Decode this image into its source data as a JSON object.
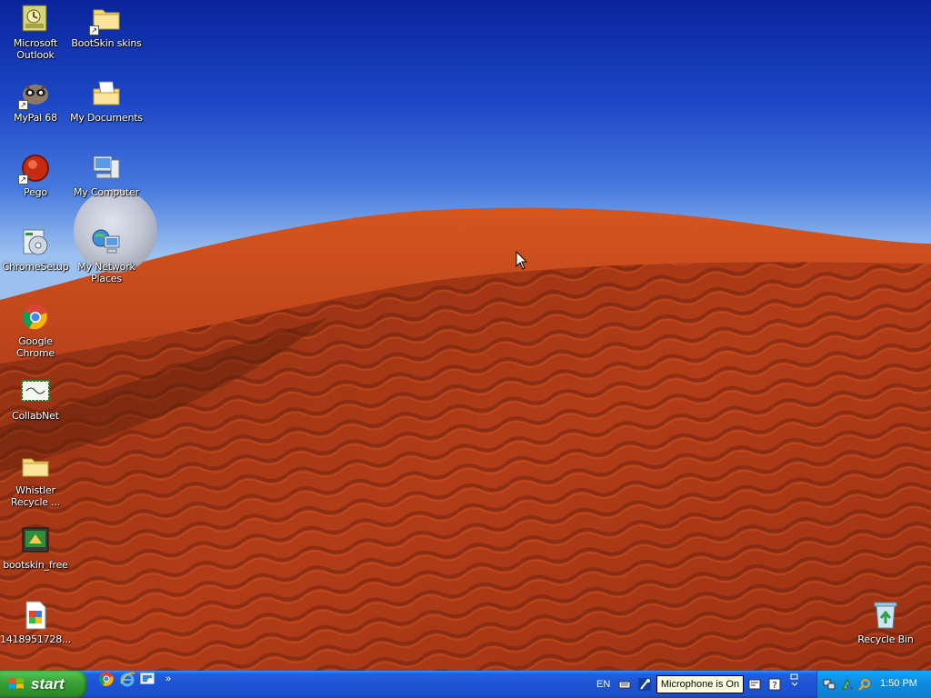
{
  "desktop": {
    "icons_left": [
      {
        "label": "Microsoft\nOutlook",
        "name": "microsoft-outlook-icon"
      },
      {
        "label": "MyPal 68",
        "name": "mypal-icon"
      },
      {
        "label": "Pego",
        "name": "pego-icon"
      },
      {
        "label": "ChromeSetup",
        "name": "chrome-setup-icon"
      },
      {
        "label": "Google Chrome",
        "name": "google-chrome-icon"
      },
      {
        "label": "CollabNet",
        "name": "collabnet-icon"
      },
      {
        "label": "Whistler\nRecycle ...",
        "name": "folder-icon"
      },
      {
        "label": "bootskin_free",
        "name": "bootskin-icon"
      },
      {
        "label": "1418951728...",
        "name": "file-icon"
      }
    ],
    "icons_right_column": [
      {
        "label": "BootSkin skins",
        "name": "folder-icon"
      },
      {
        "label": "My Documents",
        "name": "my-documents-icon"
      },
      {
        "label": "My Computer",
        "name": "my-computer-icon"
      },
      {
        "label": "My Network\nPlaces",
        "name": "network-places-icon"
      }
    ],
    "recycle_bin": {
      "label": "Recycle Bin",
      "name": "recycle-bin-icon"
    }
  },
  "taskbar": {
    "start_label": "start",
    "language": "EN",
    "mic_tooltip": "Microphone is On",
    "clock": "1:50 PM"
  },
  "colors": {
    "taskbar_blue": "#245edb",
    "start_green": "#3aa338",
    "tray_blue": "#0f8de0",
    "dune_red": "#b8401c"
  }
}
